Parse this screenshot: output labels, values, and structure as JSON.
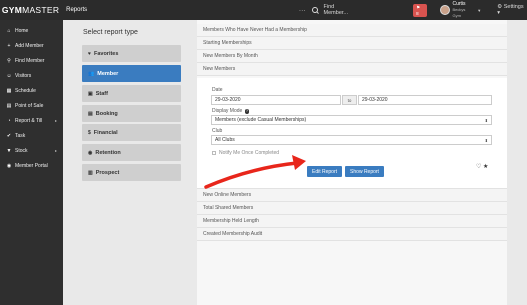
{
  "topbar": {
    "logo_gym": "GYM",
    "logo_master": "MASTER",
    "title": "Reports",
    "dots": "...",
    "search_placeholder": "Find Member...",
    "badge": "8",
    "user_name": "Curtis",
    "user_gym": "Beckys Gym",
    "settings": "Settings"
  },
  "sidebar": {
    "items": [
      {
        "label": "Home",
        "icon": "home-icon",
        "glyph": "⌂"
      },
      {
        "label": "Add Member",
        "icon": "plus-icon",
        "glyph": "+"
      },
      {
        "label": "Find Member",
        "icon": "search-icon",
        "glyph": "⚲"
      },
      {
        "label": "Visitors",
        "icon": "visitors-icon",
        "glyph": "☺"
      },
      {
        "label": "Schedule",
        "icon": "calendar-icon",
        "glyph": "▦"
      },
      {
        "label": "Point of Sale",
        "icon": "pos-icon",
        "glyph": "▤"
      },
      {
        "label": "Report & Till",
        "icon": "report-icon",
        "glyph": "◔"
      },
      {
        "label": "Task",
        "icon": "task-icon",
        "glyph": "✔"
      },
      {
        "label": "Stock",
        "icon": "stock-icon",
        "glyph": "▼"
      },
      {
        "label": "Member Portal",
        "icon": "portal-icon",
        "glyph": "◉"
      }
    ]
  },
  "report_types": {
    "title": "Select report type",
    "items": [
      {
        "label": "Favorites",
        "glyph": "♥"
      },
      {
        "label": "Member",
        "glyph": "👥"
      },
      {
        "label": "Staff",
        "glyph": "▣"
      },
      {
        "label": "Booking",
        "glyph": "▤"
      },
      {
        "label": "Financial",
        "glyph": "$"
      },
      {
        "label": "Retention",
        "glyph": "◉"
      },
      {
        "label": "Prospect",
        "glyph": "▥"
      }
    ]
  },
  "reports": {
    "top_rows": [
      "Members Who Have Never Had a Membership",
      "Starting Memberships",
      "New Members By Month",
      "New Members"
    ],
    "bottom_rows": [
      "New Online Members",
      "Total Shared Members",
      "Membership Held Length",
      "Created Membership Audit"
    ]
  },
  "detail": {
    "date_label": "Date",
    "date_from": "29-03-2020",
    "to_label": "to",
    "date_to": "29-03-2020",
    "display_mode_label": "Display Mode",
    "display_mode_value": "Members (exclude Casual Memberships)",
    "club_label": "Club",
    "club_value": "All Clubs",
    "notify_label": "Notify Me Once Completed",
    "edit_button": "Edit Report",
    "show_button": "Show Report",
    "heart": "♡",
    "star": "★"
  },
  "colors": {
    "accent": "#3a7cc0",
    "topbar": "#2b2b2b",
    "sidebar": "#2f2f2f",
    "arrow": "#e8261b"
  }
}
